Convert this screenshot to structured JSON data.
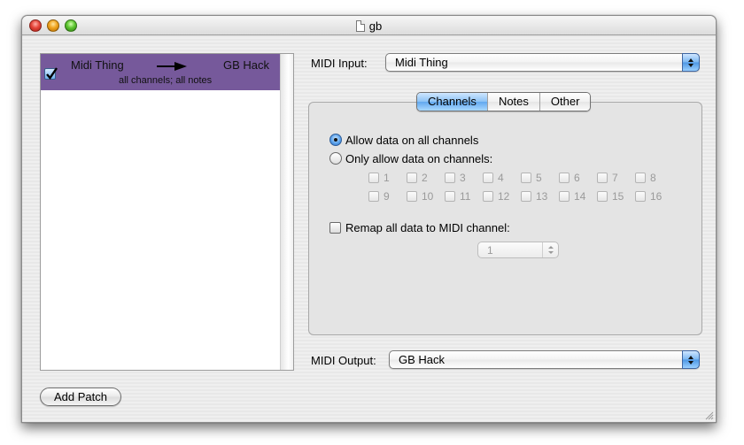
{
  "window": {
    "title": "gb",
    "title_icon": "document-icon",
    "controls": [
      "close",
      "minimize",
      "zoom"
    ]
  },
  "patches": [
    {
      "enabled": true,
      "source": "Midi Thing",
      "destination": "GB Hack",
      "summary": "all channels; all notes",
      "arrow_icon": "right-arrow-icon"
    }
  ],
  "selection_color": "#76599b",
  "add_patch_label": "Add Patch",
  "midi_input": {
    "label": "MIDI Input:",
    "value": "Midi Thing"
  },
  "midi_output": {
    "label": "MIDI Output:",
    "value": "GB Hack"
  },
  "tabs": [
    {
      "label": "Channels",
      "active": true
    },
    {
      "label": "Notes",
      "active": false
    },
    {
      "label": "Other",
      "active": false
    }
  ],
  "channels_tab": {
    "radio_all": {
      "label": "Allow data on all channels",
      "selected": true
    },
    "radio_only": {
      "label": "Only allow data on channels:",
      "selected": false
    },
    "channels": [
      "1",
      "2",
      "3",
      "4",
      "5",
      "6",
      "7",
      "8",
      "9",
      "10",
      "11",
      "12",
      "13",
      "14",
      "15",
      "16"
    ],
    "remap": {
      "label": "Remap all data to MIDI channel:",
      "checked": false,
      "channel_value": "1"
    }
  }
}
